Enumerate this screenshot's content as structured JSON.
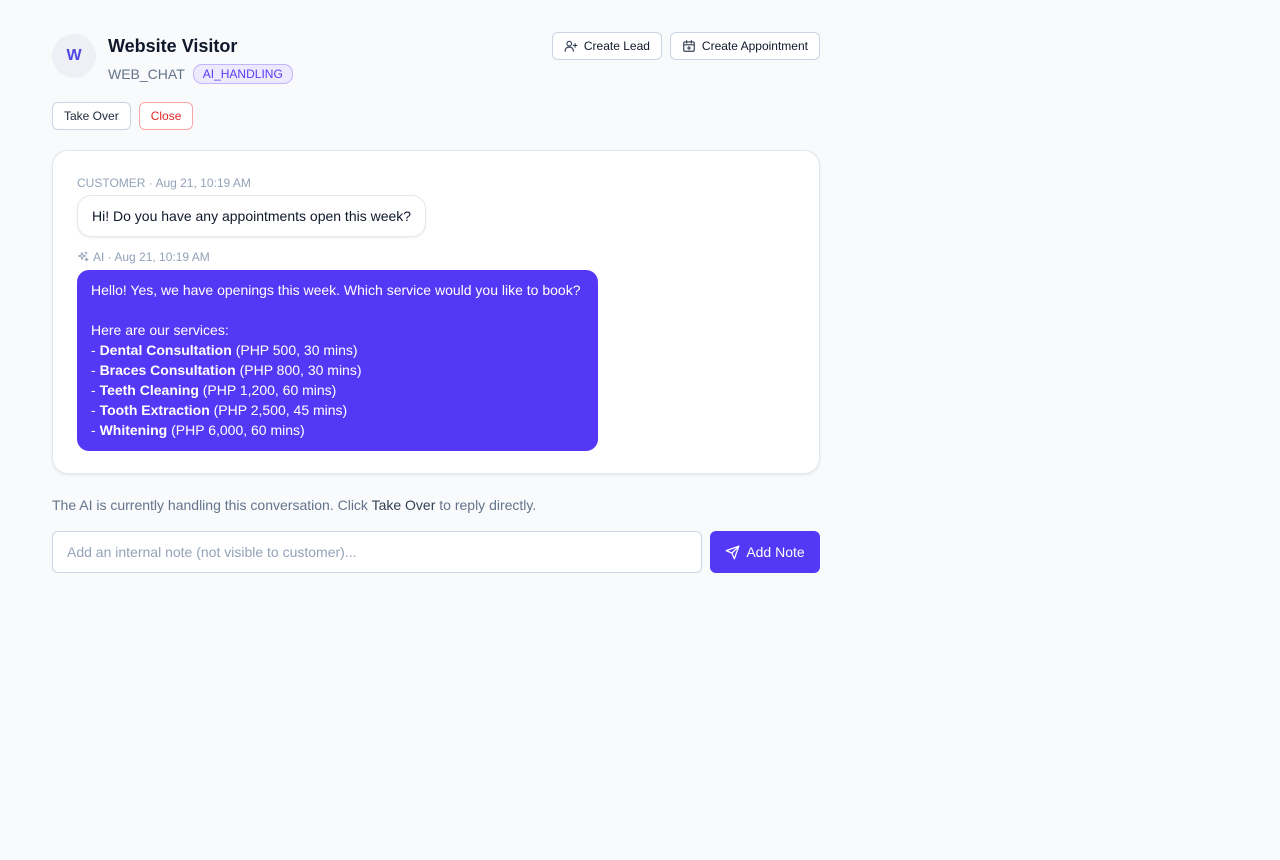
{
  "conversation": {
    "avatar_letter": "W",
    "visitor_name": "Website Visitor",
    "channel": "WEB_CHAT",
    "status_badge": "AI_HANDLING"
  },
  "header_actions": {
    "create_lead": {
      "label": "Create Lead",
      "icon": "user-plus-icon"
    },
    "create_appointment": {
      "label": "Create Appointment",
      "icon": "calendar-plus-icon"
    }
  },
  "controls": {
    "take_over": "Take Over",
    "close": "Close"
  },
  "messages": {
    "customer": {
      "meta": "CUSTOMER · Aug 21, 10:19 AM",
      "text": "Hi! Do you have any appointments open this week?"
    },
    "ai": {
      "meta": "AI · Aug 21, 10:19 AM",
      "icon": "sparkle-icon",
      "intro": "Hello! Yes, we have openings this week. Which service would you like to book?",
      "services_heading": "Here are our services:",
      "services": [
        {
          "name": "Dental Consultation",
          "details": "(PHP 500, 30 mins)"
        },
        {
          "name": "Braces Consultation",
          "details": "(PHP 800, 30 mins)"
        },
        {
          "name": "Teeth Cleaning",
          "details": "(PHP 1,200, 60 mins)"
        },
        {
          "name": "Tooth Extraction",
          "details": "(PHP 2,500, 45 mins)"
        },
        {
          "name": "Whitening",
          "details": "(PHP 6,000, 60 mins)"
        }
      ]
    }
  },
  "status": {
    "before": "The AI is currently handling this conversation. Click ",
    "emphasis": "Take Over",
    "after": " to reply directly."
  },
  "note": {
    "value": "",
    "placeholder": "Add an internal note (not visible to customer)...",
    "button_label": "Add Note",
    "button_icon": "send-icon"
  },
  "colors": {
    "accent": "#5438f5",
    "badge_bg": "#ede9fe",
    "danger": "#dc2626",
    "background": "#f8fafc"
  }
}
